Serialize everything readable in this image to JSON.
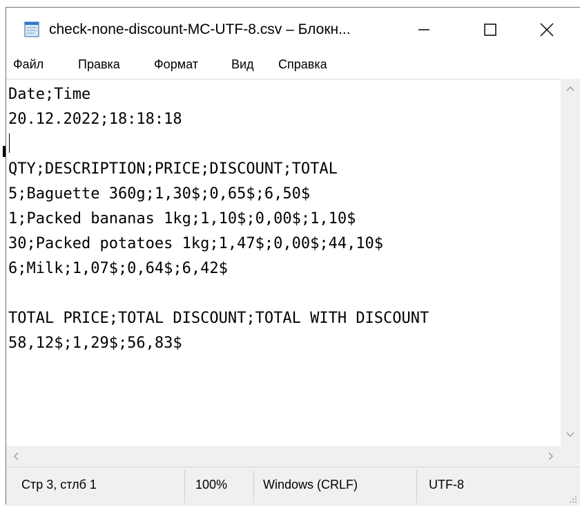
{
  "window": {
    "title": "check-none-discount-MC-UTF-8.csv – Блокн..."
  },
  "menu": {
    "items": [
      "Файл",
      "Правка",
      "Формат",
      "Вид",
      "Справка"
    ]
  },
  "editor": {
    "lines": [
      "Date;Time",
      "20.12.2022;18:18:18",
      "",
      "QTY;DESCRIPTION;PRICE;DISCOUNT;TOTAL",
      "5;Baguette 360g;1,30$;0,65$;6,50$",
      "1;Packed bananas 1kg;1,10$;0,00$;1,10$",
      "30;Packed potatoes 1kg;1,47$;0,00$;44,10$",
      "6;Milk;1,07$;0,64$;6,42$",
      "",
      "TOTAL PRICE;TOTAL DISCOUNT;TOTAL WITH DISCOUNT",
      "58,12$;1,29$;56,83$"
    ]
  },
  "status": {
    "position": "Стр 3, стлб 1",
    "zoom": "100%",
    "line_ending": "Windows (CRLF)",
    "encoding": "UTF-8"
  },
  "icons": {
    "app": "notepad-icon",
    "minimize": "minimize-icon",
    "maximize": "maximize-icon",
    "close": "close-icon",
    "scroll_up": "chevron-up-icon",
    "scroll_down": "chevron-down-icon",
    "scroll_left": "chevron-left-icon",
    "scroll_right": "chevron-right-icon",
    "resize": "resize-grip-icon"
  }
}
